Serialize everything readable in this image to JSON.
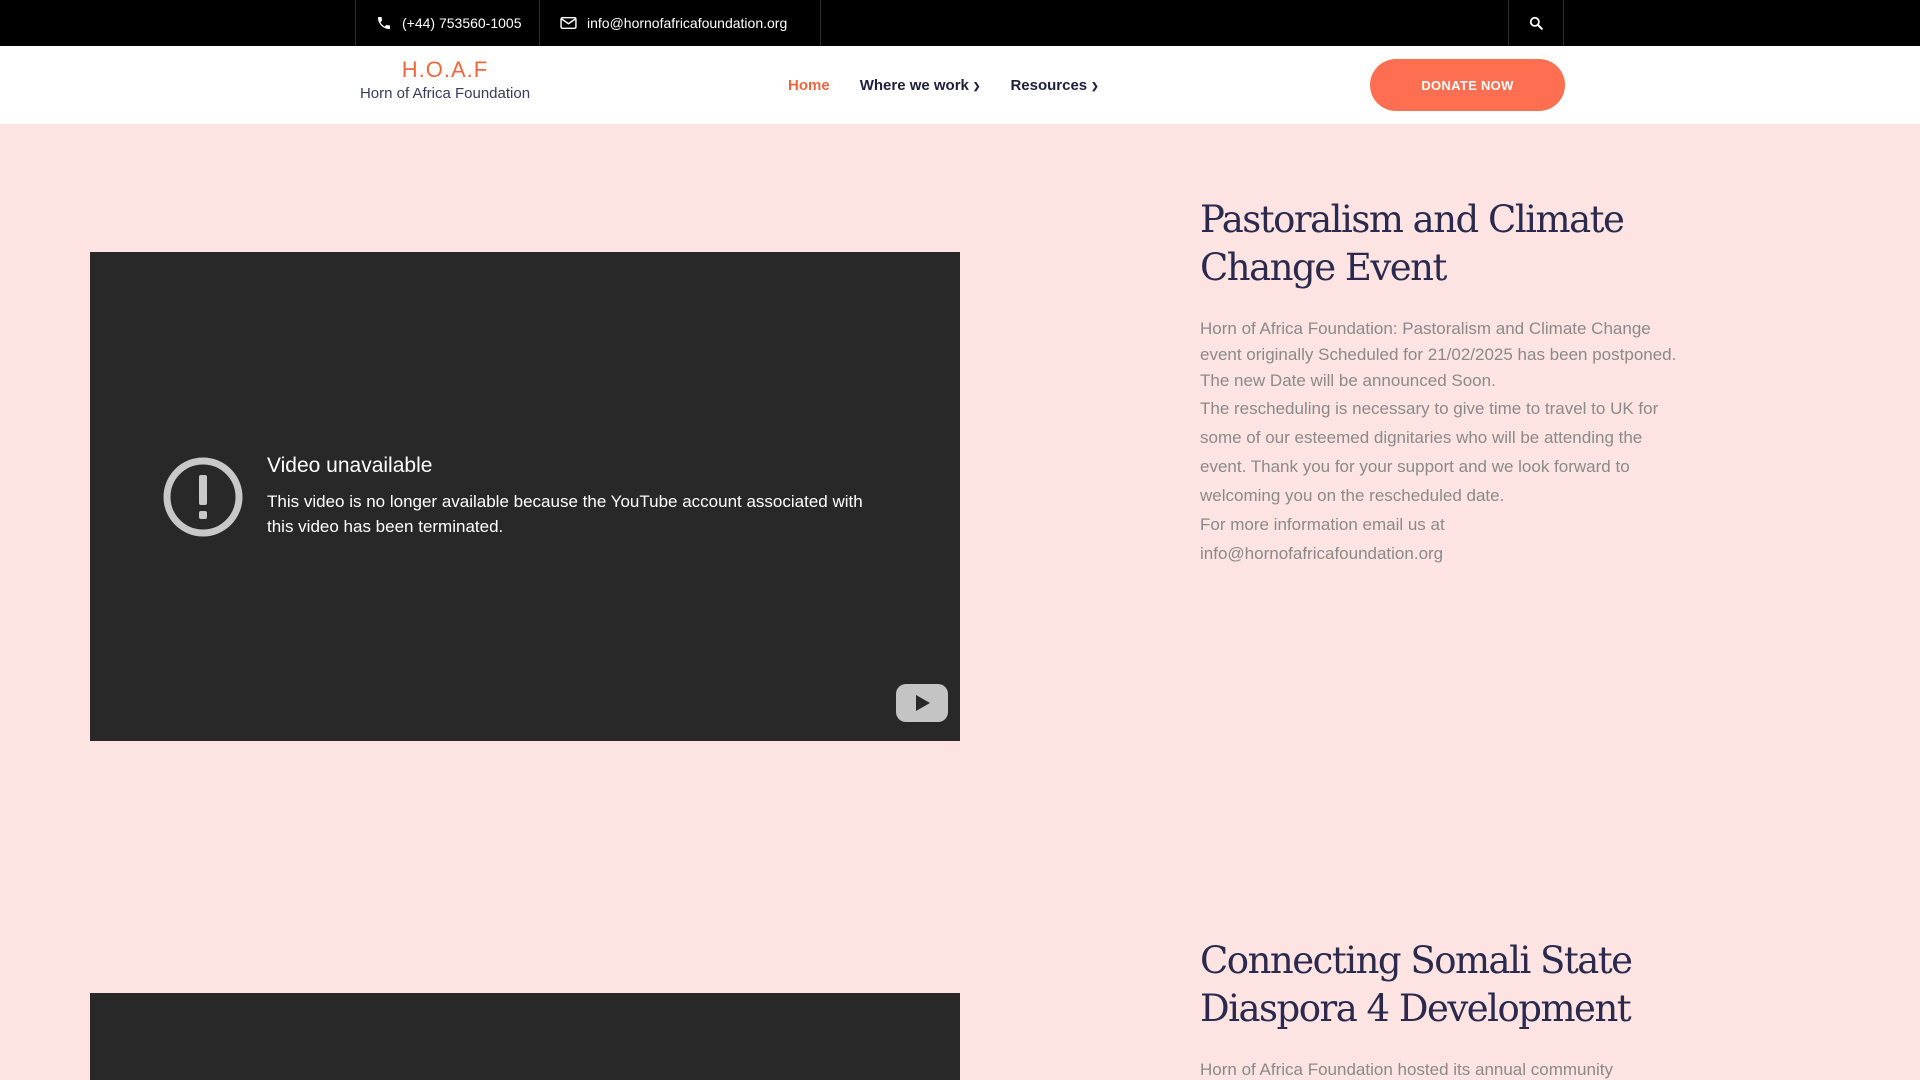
{
  "topbar": {
    "phone": "(+44) 753560-1005",
    "email": "info@hornofafricafoundation.org",
    "icons": {
      "phone": "phone-icon",
      "email": "envelope-icon",
      "search": "search-icon"
    }
  },
  "header": {
    "logo_title": "H.O.A.F",
    "logo_subtitle": "Horn of Africa Foundation",
    "nav": [
      {
        "label": "Home",
        "active": true
      },
      {
        "label": "Where we work",
        "dropdown": true
      },
      {
        "label": "Resources",
        "dropdown": true
      }
    ],
    "donate_label": "DONATE NOW"
  },
  "videos": [
    {
      "error_title": "Video unavailable",
      "error_message": "This video is no longer available because the YouTube account associated with this video has been terminated."
    },
    {}
  ],
  "events": [
    {
      "title": "Pastoralism and Climate Change Event",
      "paragraphs": [
        "Horn of Africa Foundation: Pastoralism and Climate Change event originally Scheduled for 21/02/2025 has been postponed. The new Date will be announced Soon.",
        "The rescheduling is necessary to give time to travel to UK for some of our esteemed dignitaries who will be attending the event. Thank you for your support and we look forward to welcoming you on the rescheduled date.",
        "For more information email us at info@hornofafricafoundation.org"
      ]
    },
    {
      "title": "Connecting Somali State Diaspora 4 Development",
      "paragraphs": [
        "Horn of Africa Foundation hosted its annual community"
      ]
    }
  ],
  "colors": {
    "accent": "#f0673f",
    "donate": "#fd6f50",
    "page_bg": "#fde3e1",
    "heading": "#2a2a4e",
    "body_text": "#8a8a8a"
  }
}
